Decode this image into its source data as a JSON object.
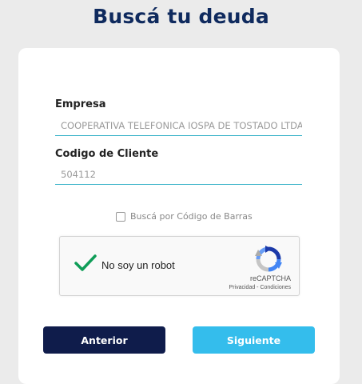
{
  "page": {
    "title": "Buscá tu deuda"
  },
  "form": {
    "empresa_label": "Empresa",
    "empresa_value": "COOPERATIVA TELEFONICA IOSPA DE TOSTADO LTDA",
    "cliente_label": "Codigo de Cliente",
    "cliente_value": "504112",
    "barcode_label": "Buscá por Código de Barras",
    "barcode_checked": false
  },
  "captcha": {
    "label": "No soy un robot",
    "brand": "reCAPTCHA",
    "privacy": "Privacidad",
    "separator": " - ",
    "terms": "Condiciones",
    "checked": true
  },
  "buttons": {
    "prev": "Anterior",
    "next": "Siguiente"
  },
  "colors": {
    "title": "#0f2a5e",
    "accent_line": "#3bb3c9",
    "btn_prev": "#0f1c4b",
    "btn_next": "#34bdec",
    "check": "#0f9d58"
  }
}
